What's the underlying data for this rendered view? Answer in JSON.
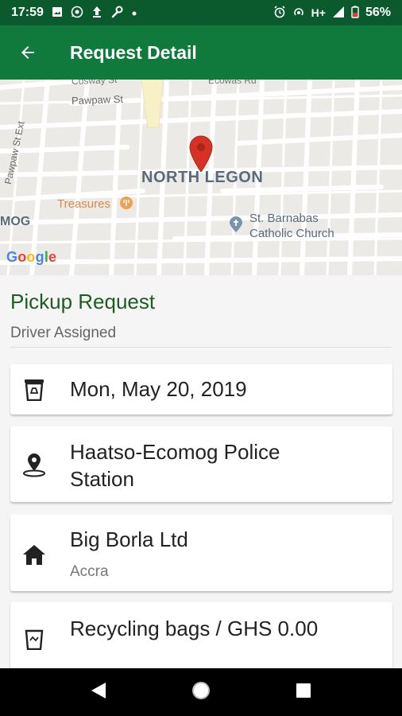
{
  "status_bar": {
    "time": "17:59",
    "network": "H+",
    "battery": "56%",
    "left_icons": [
      "image-icon",
      "whatsapp-icon",
      "upload-icon",
      "wrench-icon",
      "dot-icon"
    ],
    "right_icons": [
      "alarm-icon",
      "hotspot-icon",
      "signal-icon",
      "battery-icon"
    ]
  },
  "app_bar": {
    "title": "Request Detail",
    "back_icon": "arrow-left-icon",
    "color": "#0f7a3c"
  },
  "map": {
    "area_label": "NORTH LEGON",
    "streets": [
      "Cosway St",
      "Ecowas Rd",
      "Pawpaw St",
      "Pawpaw St Ext"
    ],
    "places": [
      "Treasures",
      "St. Barnabas",
      "Catholic Church",
      "MOG"
    ],
    "logo": "Google",
    "marker_color": "#d93025"
  },
  "request": {
    "title": "Pickup Request",
    "status": "Driver Assigned",
    "date": "Mon, May 20, 2019",
    "location_line1": "Haatso-Ecomog Police",
    "location_line2": "Station",
    "company": "Big Borla Ltd",
    "company_city": "Accra",
    "item": "Recycling bags / GHS 0.00"
  },
  "icons": {
    "date": "recycle-bin-icon",
    "location": "location-pin-icon",
    "company": "home-icon",
    "item": "recycle-bag-icon"
  },
  "colors": {
    "status_bar": "#0b5a2e",
    "title_green": "#1b5e20"
  }
}
